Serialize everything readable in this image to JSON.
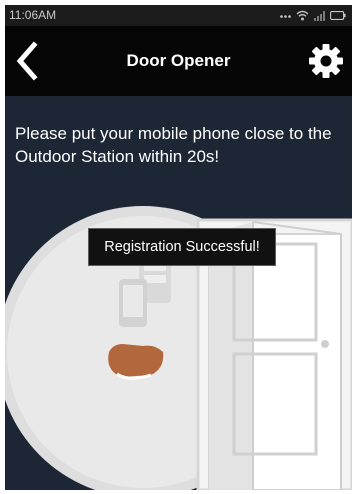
{
  "status_bar": {
    "time": "11:06AM",
    "icons": [
      "more-icon",
      "wifi-icon",
      "signal-icon",
      "battery-icon"
    ]
  },
  "header": {
    "back_icon": "chevron-left-icon",
    "title": "Door Opener",
    "settings_icon": "gear-icon"
  },
  "main": {
    "instruction": "Please put your mobile phone close to the Outdoor Station within 20s!",
    "illustration_icons": [
      "outdoor-station-icon",
      "hand-phone-icon",
      "open-door-icon"
    ]
  },
  "toast": {
    "message": "Registration Successful!"
  },
  "colors": {
    "background": "#1d2634",
    "navbar": "#050505",
    "status_bar": "#1b1b1b",
    "illustration_fill": "#e6e6e6",
    "illustration_line": "#d6d6d6",
    "skin": "#b3673c"
  }
}
